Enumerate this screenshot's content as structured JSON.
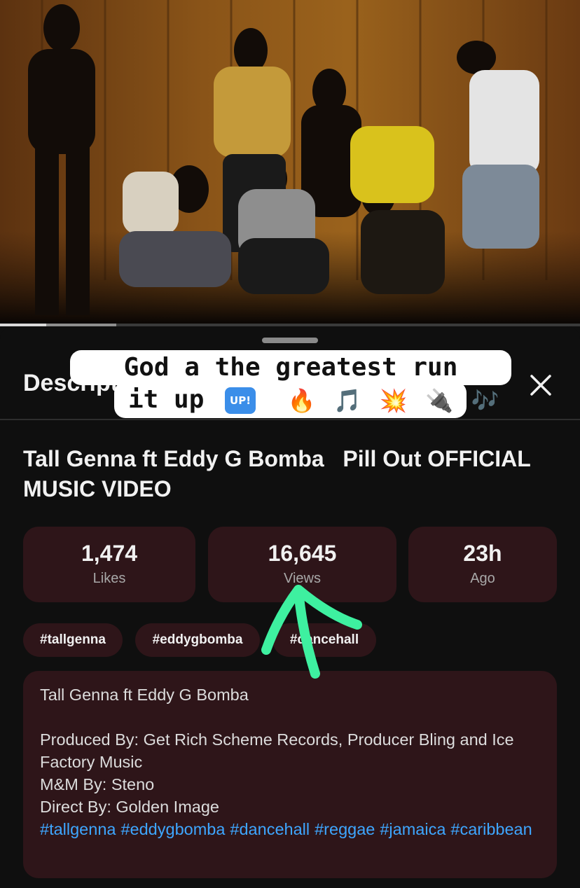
{
  "sheet": {
    "title": "Description",
    "close_icon": "close-icon"
  },
  "video": {
    "title": "Tall Genna ft Eddy G Bomba   Pill Out OFFICIAL MUSIC VIDEO",
    "progress_fraction": 0.08,
    "buffered_fraction": 0.2
  },
  "stats": [
    {
      "value": "1,474",
      "label": "Likes"
    },
    {
      "value": "16,645",
      "label": "Views"
    },
    {
      "value": "23h",
      "label": "Ago"
    }
  ],
  "chips": [
    "#tallgenna",
    "#eddygbomba",
    "#dancehall"
  ],
  "description": {
    "line1": "Tall Genna ft Eddy G Bomba",
    "line2": "Produced By: Get Rich Scheme Records, Producer Bling and Ice Factory Music",
    "line3": "M&M By: Steno",
    "line4": "Direct By: Golden Image",
    "hashtags": [
      "#tallgenna",
      "#eddygbomba",
      "#dancehall",
      "#reggae",
      "#jamaica",
      "#caribbean"
    ]
  },
  "overlay": {
    "line1": "God a the greatest run",
    "line2": "it up",
    "up_badge": "UP!",
    "emojis": [
      "🔥",
      "🎵",
      "💥",
      "🔌",
      "🎶"
    ],
    "arrow_color": "#3ef0a0"
  },
  "colors": {
    "card_bg": "#2e1519",
    "link": "#3ea6ff",
    "background": "#0f0f0f"
  }
}
